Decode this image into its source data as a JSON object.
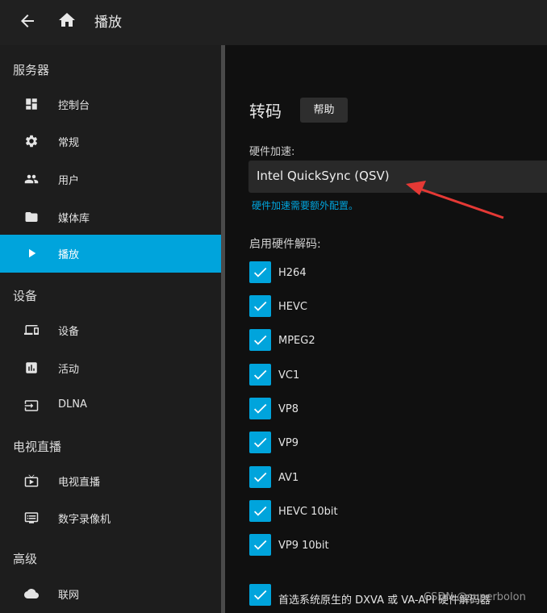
{
  "header": {
    "title": "播放"
  },
  "sidebar": {
    "sections": [
      {
        "title": "服务器",
        "items": [
          {
            "label": "控制台",
            "icon": "dashboard-icon"
          },
          {
            "label": "常规",
            "icon": "gear-icon"
          },
          {
            "label": "用户",
            "icon": "people-icon"
          },
          {
            "label": "媒体库",
            "icon": "folder-icon"
          },
          {
            "label": "播放",
            "icon": "play-icon",
            "active": true
          }
        ]
      },
      {
        "title": "设备",
        "items": [
          {
            "label": "设备",
            "icon": "devices-icon"
          },
          {
            "label": "活动",
            "icon": "activity-icon"
          },
          {
            "label": "DLNA",
            "icon": "input-icon"
          }
        ]
      },
      {
        "title": "电视直播",
        "items": [
          {
            "label": "电视直播",
            "icon": "live-tv-icon"
          },
          {
            "label": "数字录像机",
            "icon": "dvr-icon"
          }
        ]
      },
      {
        "title": "高级",
        "items": [
          {
            "label": "联网",
            "icon": "cloud-icon"
          }
        ]
      }
    ]
  },
  "main": {
    "heading": "转码",
    "help_label": "帮助",
    "hw_accel_label": "硬件加速:",
    "hw_accel_value": "Intel QuickSync (QSV)",
    "hw_hint": "硬件加速需要额外配置。",
    "decode_title": "启用硬件解码:",
    "codecs": [
      {
        "label": "H264",
        "checked": true
      },
      {
        "label": "HEVC",
        "checked": true
      },
      {
        "label": "MPEG2",
        "checked": true
      },
      {
        "label": "VC1",
        "checked": true
      },
      {
        "label": "VP8",
        "checked": true
      },
      {
        "label": "VP9",
        "checked": true
      },
      {
        "label": "AV1",
        "checked": true
      },
      {
        "label": "HEVC 10bit",
        "checked": true
      },
      {
        "label": "VP9 10bit",
        "checked": true
      }
    ],
    "prefer_native": {
      "label": "首选系统原生的 DXVA 或 VA-API 硬件解码器",
      "checked": true
    }
  },
  "watermark": "CSDN @superbolon",
  "colors": {
    "accent": "#00a4dc",
    "annotation": "#e53935",
    "sidebar_bg": "#1d1d1d",
    "page_bg": "#101010"
  }
}
